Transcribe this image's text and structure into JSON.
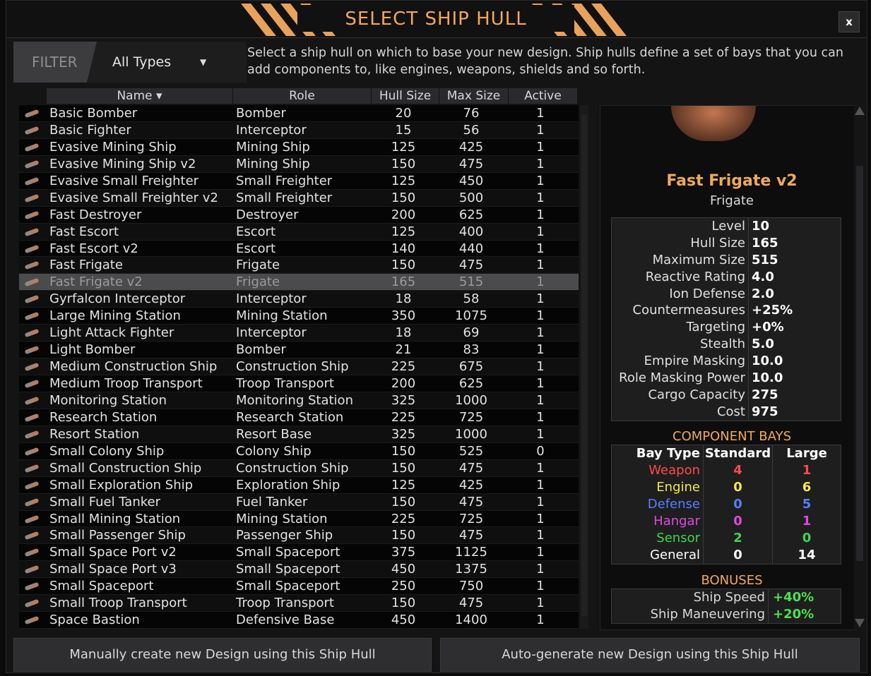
{
  "title": "SELECT SHIP HULL",
  "close_label": "x",
  "filter": {
    "label": "FILTER",
    "value": "All Types"
  },
  "description": "Select a ship hull on which to base your new design. Ship hulls define a set of bays that you can add components to, like engines, weapons, shields and so forth.",
  "columns": {
    "name": "Name",
    "role": "Role",
    "hull": "Hull Size",
    "max": "Max Size",
    "active": "Active"
  },
  "rows": [
    {
      "name": "Basic Bomber",
      "role": "Bomber",
      "hull": "20",
      "max": "76",
      "active": "1"
    },
    {
      "name": "Basic Fighter",
      "role": "Interceptor",
      "hull": "15",
      "max": "56",
      "active": "1"
    },
    {
      "name": "Evasive Mining Ship",
      "role": "Mining Ship",
      "hull": "125",
      "max": "425",
      "active": "1"
    },
    {
      "name": "Evasive Mining Ship v2",
      "role": "Mining Ship",
      "hull": "150",
      "max": "475",
      "active": "1"
    },
    {
      "name": "Evasive Small Freighter",
      "role": "Small Freighter",
      "hull": "125",
      "max": "450",
      "active": "1"
    },
    {
      "name": "Evasive Small Freighter v2",
      "role": "Small Freighter",
      "hull": "150",
      "max": "500",
      "active": "1"
    },
    {
      "name": "Fast Destroyer",
      "role": "Destroyer",
      "hull": "200",
      "max": "625",
      "active": "1"
    },
    {
      "name": "Fast Escort",
      "role": "Escort",
      "hull": "125",
      "max": "400",
      "active": "1"
    },
    {
      "name": "Fast Escort v2",
      "role": "Escort",
      "hull": "140",
      "max": "440",
      "active": "1"
    },
    {
      "name": "Fast Frigate",
      "role": "Frigate",
      "hull": "150",
      "max": "475",
      "active": "1"
    },
    {
      "name": "Fast Frigate v2",
      "role": "Frigate",
      "hull": "165",
      "max": "515",
      "active": "1"
    },
    {
      "name": "Gyrfalcon Interceptor",
      "role": "Interceptor",
      "hull": "18",
      "max": "58",
      "active": "1"
    },
    {
      "name": "Large Mining Station",
      "role": "Mining Station",
      "hull": "350",
      "max": "1075",
      "active": "1"
    },
    {
      "name": "Light Attack Fighter",
      "role": "Interceptor",
      "hull": "18",
      "max": "69",
      "active": "1"
    },
    {
      "name": "Light Bomber",
      "role": "Bomber",
      "hull": "21",
      "max": "83",
      "active": "1"
    },
    {
      "name": "Medium Construction Ship",
      "role": "Construction Ship",
      "hull": "225",
      "max": "675",
      "active": "1"
    },
    {
      "name": "Medium Troop Transport",
      "role": "Troop Transport",
      "hull": "200",
      "max": "625",
      "active": "1"
    },
    {
      "name": "Monitoring Station",
      "role": "Monitoring Station",
      "hull": "325",
      "max": "1000",
      "active": "1"
    },
    {
      "name": "Research Station",
      "role": "Research Station",
      "hull": "225",
      "max": "725",
      "active": "1"
    },
    {
      "name": "Resort Station",
      "role": "Resort Base",
      "hull": "325",
      "max": "1000",
      "active": "1"
    },
    {
      "name": "Small Colony Ship",
      "role": "Colony Ship",
      "hull": "150",
      "max": "525",
      "active": "0"
    },
    {
      "name": "Small Construction Ship",
      "role": "Construction Ship",
      "hull": "150",
      "max": "475",
      "active": "1"
    },
    {
      "name": "Small Exploration Ship",
      "role": "Exploration Ship",
      "hull": "125",
      "max": "425",
      "active": "1"
    },
    {
      "name": "Small Fuel Tanker",
      "role": "Fuel Tanker",
      "hull": "150",
      "max": "475",
      "active": "1"
    },
    {
      "name": "Small Mining Station",
      "role": "Mining Station",
      "hull": "225",
      "max": "725",
      "active": "1"
    },
    {
      "name": "Small Passenger Ship",
      "role": "Passenger Ship",
      "hull": "150",
      "max": "475",
      "active": "1"
    },
    {
      "name": "Small Space Port v2",
      "role": "Small Spaceport",
      "hull": "375",
      "max": "1125",
      "active": "1"
    },
    {
      "name": "Small Space Port v3",
      "role": "Small Spaceport",
      "hull": "450",
      "max": "1375",
      "active": "1"
    },
    {
      "name": "Small Spaceport",
      "role": "Small Spaceport",
      "hull": "250",
      "max": "750",
      "active": "1"
    },
    {
      "name": "Small Troop Transport",
      "role": "Troop Transport",
      "hull": "150",
      "max": "475",
      "active": "1"
    },
    {
      "name": "Space Bastion",
      "role": "Defensive Base",
      "hull": "450",
      "max": "1400",
      "active": "1"
    }
  ],
  "selected_index": 10,
  "detail": {
    "name": "Fast Frigate v2",
    "role": "Frigate",
    "stats": [
      {
        "label": "Level",
        "value": "10"
      },
      {
        "label": "Hull Size",
        "value": "165"
      },
      {
        "label": "Maximum Size",
        "value": "515"
      },
      {
        "label": "Reactive Rating",
        "value": "4.0"
      },
      {
        "label": "Ion Defense",
        "value": "2.0"
      },
      {
        "label": "Countermeasures",
        "value": "+25%"
      },
      {
        "label": "Targeting",
        "value": "+0%"
      },
      {
        "label": "Stealth",
        "value": "5.0"
      },
      {
        "label": "Empire Masking Power",
        "value": "10.0"
      },
      {
        "label": "Role Masking Power",
        "value": "10.0"
      },
      {
        "label": "Cargo Capacity",
        "value": "275"
      },
      {
        "label": "Cost",
        "value": "975"
      }
    ],
    "bays_title": "COMPONENT BAYS",
    "bays_header": {
      "type": "Bay Type",
      "std": "Standard",
      "large": "Large"
    },
    "bays": [
      {
        "type": "Weapon",
        "std": "4",
        "large": "1",
        "color": "#ff4a4a"
      },
      {
        "type": "Engine",
        "std": "0",
        "large": "6",
        "color": "#f2e94a"
      },
      {
        "type": "Defense",
        "std": "0",
        "large": "5",
        "color": "#5a7dff"
      },
      {
        "type": "Hangar",
        "std": "0",
        "large": "1",
        "color": "#e04adf"
      },
      {
        "type": "Sensor",
        "std": "2",
        "large": "0",
        "color": "#3fd44f"
      },
      {
        "type": "General",
        "std": "0",
        "large": "14",
        "color": "#ffffff"
      }
    ],
    "bonuses_title": "BONUSES",
    "bonuses": [
      {
        "label": "Ship Speed",
        "value": "+40%"
      },
      {
        "label": "Ship Maneuvering",
        "value": "+20%"
      }
    ]
  },
  "buttons": {
    "manual": "Manually create new Design using this Ship Hull",
    "auto": "Auto-generate new Design using this Ship Hull"
  }
}
